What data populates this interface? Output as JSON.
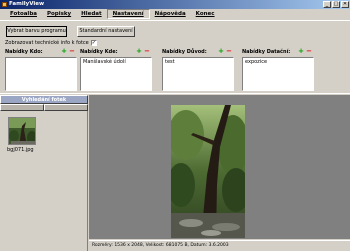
{
  "window": {
    "title": "FamilyView",
    "buttons": [
      "_",
      "□",
      "✕"
    ]
  },
  "menu": [
    {
      "label": "Fotoalba",
      "active": false
    },
    {
      "label": "Popisky",
      "active": false
    },
    {
      "label": "Hledat",
      "active": false
    },
    {
      "label": "Nastavení",
      "active": true
    },
    {
      "label": "Nápověda",
      "active": false
    },
    {
      "label": "Konec",
      "active": false
    }
  ],
  "toolbar": {
    "select_program": "Vybrat barvu programu",
    "default_settings": "Standardní nastavení"
  },
  "options": {
    "show_tech_info": "Zobrazovat technické info k fotce",
    "show_tech_info_checked": "✓"
  },
  "lists": [
    {
      "label": "Nabídky Kdo:",
      "plus": "+",
      "minus": "−",
      "items": []
    },
    {
      "label": "Nabídky Kde:",
      "plus": "+",
      "minus": "−",
      "items": [
        "Manšlavské údolí"
      ]
    },
    {
      "label": "Nabídky Důvod:",
      "plus": "+",
      "minus": "−",
      "items": [
        "test"
      ]
    },
    {
      "label": "Nabídky Datační:",
      "plus": "+",
      "minus": "−",
      "items": [
        "expozice"
      ]
    }
  ],
  "search": {
    "header": "Vyhledání fotek"
  },
  "thumbnails": [
    {
      "filename": "bgj071.jpg"
    }
  ],
  "status": {
    "text": "Rozměry: 1536 x 2048, Velikost: 681075 B, Datum: 3.6.2003"
  },
  "colors": {
    "titlebar_start": "#0a246a",
    "titlebar_end": "#a6caf0",
    "face": "#d4d0c8",
    "viewer_bg": "#808080",
    "plus": "#00a000",
    "minus": "#e00000"
  }
}
